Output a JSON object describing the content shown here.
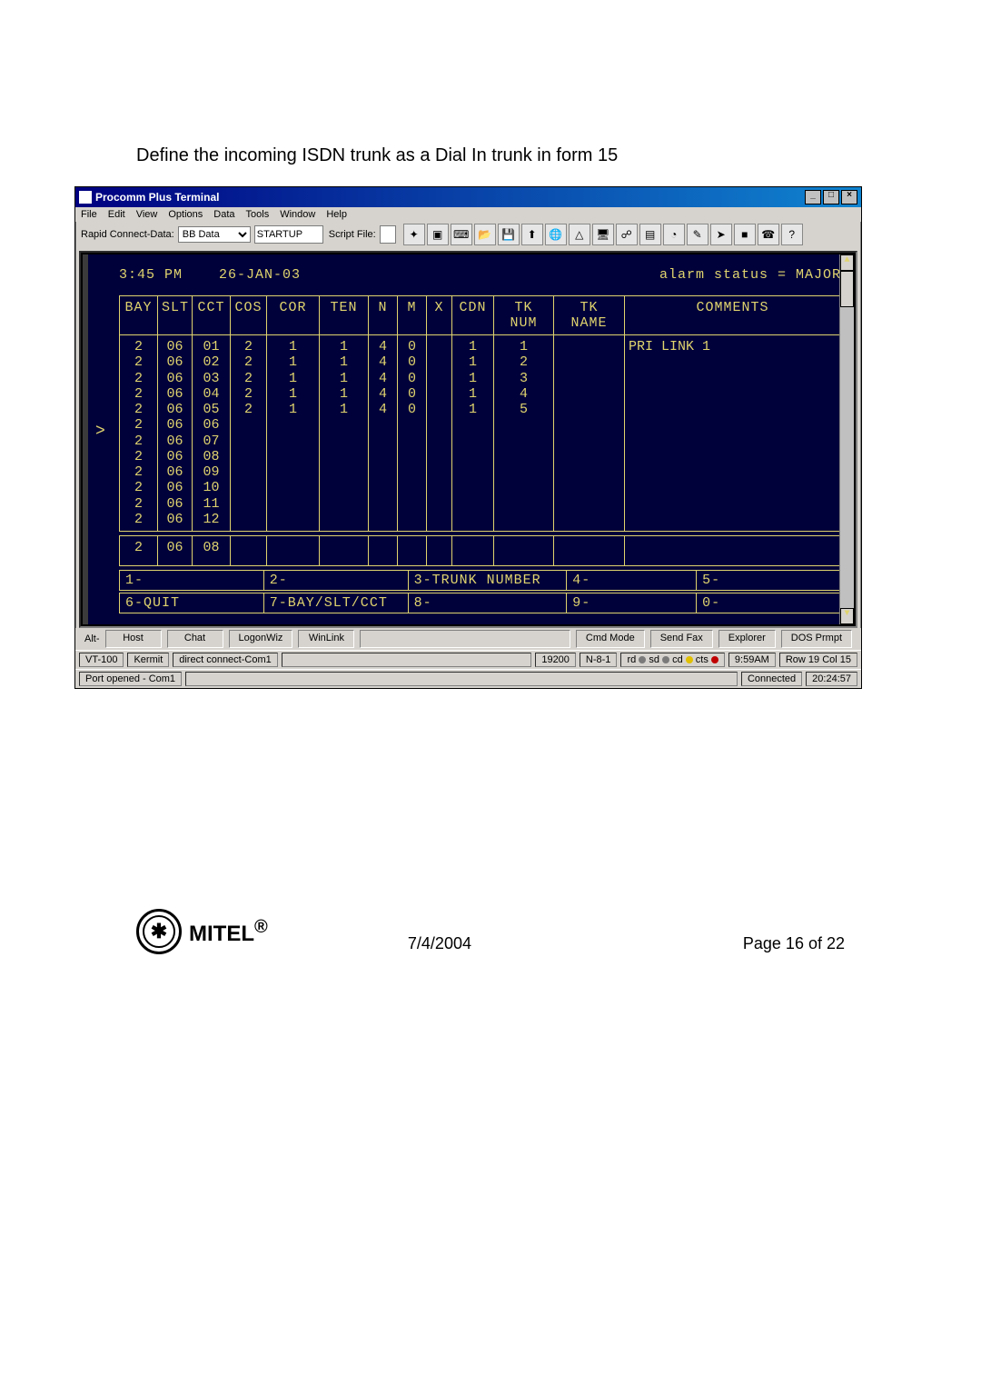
{
  "page": {
    "instruction": "Define the incoming ISDN trunk as a Dial In trunk in form 15"
  },
  "window": {
    "title": "Procomm Plus Terminal",
    "menus": [
      "File",
      "Edit",
      "View",
      "Options",
      "Data",
      "Tools",
      "Window",
      "Help"
    ],
    "tool": {
      "rapid_connect_label": "Rapid Connect-Data:",
      "rapid_connect_value": "BB Data",
      "script_file_label": "Script File:",
      "script_file_value": "STARTUP"
    },
    "toolbar_icons": [
      "run-icon",
      "book-icon",
      "keypad-icon",
      "folder-open-icon",
      "folder-save-icon",
      "upload-icon",
      "globe-icon",
      "triangle-icon",
      "monitor-icon",
      "script-icon",
      "page-icon",
      "clock-icon",
      "paint-icon",
      "arrow-icon",
      "stop-icon",
      "phone-icon",
      "help-icon"
    ]
  },
  "terminal": {
    "time": "3:45 PM",
    "date": "26-JAN-03",
    "alarm": "alarm status = MAJOR",
    "headers": [
      "BAY",
      "SLT",
      "CCT",
      "COS",
      "COR",
      "TEN",
      "N",
      "M",
      "X",
      "CDN",
      "TK NUM",
      "TK NAME",
      "COMMENTS"
    ],
    "rows": [
      {
        "bay": "2",
        "slt": "06",
        "cct": "01",
        "cos": "2",
        "cor": "1",
        "ten": "1",
        "n": "4",
        "m": "0",
        "x": "",
        "cdn": "1",
        "tknum": "1",
        "tkname": "",
        "comments": "PRI LINK 1"
      },
      {
        "bay": "2",
        "slt": "06",
        "cct": "02",
        "cos": "2",
        "cor": "1",
        "ten": "1",
        "n": "4",
        "m": "0",
        "x": "",
        "cdn": "1",
        "tknum": "2",
        "tkname": "",
        "comments": ""
      },
      {
        "bay": "2",
        "slt": "06",
        "cct": "03",
        "cos": "2",
        "cor": "1",
        "ten": "1",
        "n": "4",
        "m": "0",
        "x": "",
        "cdn": "1",
        "tknum": "3",
        "tkname": "",
        "comments": ""
      },
      {
        "bay": "2",
        "slt": "06",
        "cct": "04",
        "cos": "2",
        "cor": "1",
        "ten": "1",
        "n": "4",
        "m": "0",
        "x": "",
        "cdn": "1",
        "tknum": "4",
        "tkname": "",
        "comments": ""
      },
      {
        "bay": "2",
        "slt": "06",
        "cct": "05",
        "cos": "2",
        "cor": "1",
        "ten": "1",
        "n": "4",
        "m": "0",
        "x": "",
        "cdn": "1",
        "tknum": "5",
        "tkname": "",
        "comments": ""
      },
      {
        "bay": "2",
        "slt": "06",
        "cct": "06",
        "cos": "",
        "cor": "",
        "ten": "",
        "n": "",
        "m": "",
        "x": "",
        "cdn": "",
        "tknum": "",
        "tkname": "",
        "comments": ""
      },
      {
        "bay": "2",
        "slt": "06",
        "cct": "07",
        "cos": "",
        "cor": "",
        "ten": "",
        "n": "",
        "m": "",
        "x": "",
        "cdn": "",
        "tknum": "",
        "tkname": "",
        "comments": ""
      },
      {
        "bay": "2",
        "slt": "06",
        "cct": "08",
        "cos": "",
        "cor": "",
        "ten": "",
        "n": "",
        "m": "",
        "x": "",
        "cdn": "",
        "tknum": "",
        "tkname": "",
        "comments": ""
      },
      {
        "bay": "2",
        "slt": "06",
        "cct": "09",
        "cos": "",
        "cor": "",
        "ten": "",
        "n": "",
        "m": "",
        "x": "",
        "cdn": "",
        "tknum": "",
        "tkname": "",
        "comments": ""
      },
      {
        "bay": "2",
        "slt": "06",
        "cct": "10",
        "cos": "",
        "cor": "",
        "ten": "",
        "n": "",
        "m": "",
        "x": "",
        "cdn": "",
        "tknum": "",
        "tkname": "",
        "comments": ""
      },
      {
        "bay": "2",
        "slt": "06",
        "cct": "11",
        "cos": "",
        "cor": "",
        "ten": "",
        "n": "",
        "m": "",
        "x": "",
        "cdn": "",
        "tknum": "",
        "tkname": "",
        "comments": ""
      },
      {
        "bay": "2",
        "slt": "06",
        "cct": "12",
        "cos": "",
        "cor": "",
        "ten": "",
        "n": "",
        "m": "",
        "x": "",
        "cdn": "",
        "tknum": "",
        "tkname": "",
        "comments": ""
      }
    ],
    "cursor_row": {
      "bay": "2",
      "slt": "06",
      "cct": "08"
    },
    "fkeys": {
      "r1": {
        "c1": "1-",
        "c2": "2-",
        "c3": "3-TRUNK NUMBER",
        "c4": "4-",
        "c5": "5-"
      },
      "r2": {
        "c1": "6-QUIT",
        "c2": "7-BAY/SLT/CCT",
        "c3": "8-",
        "c4": "9-",
        "c5": "0-"
      }
    }
  },
  "bottom_buttons": {
    "alt": "Alt-",
    "items": [
      "Host",
      "Chat",
      "LogonWiz",
      "WinLink",
      "",
      "Cmd Mode",
      "Send Fax",
      "Explorer",
      "DOS Prmpt"
    ]
  },
  "status1": {
    "term": "VT-100",
    "proto": "Kermit",
    "conn": "direct connect-Com1",
    "baud": "19200",
    "bits": "N-8-1",
    "leds": "rd  sd  cd  cts",
    "time": "9:59AM",
    "rowcol": "Row 19  Col 15"
  },
  "status2": {
    "port": "Port opened - Com1",
    "connected": "Connected",
    "elapsed": "20:24:57"
  },
  "doc_footer": {
    "brand": "MITEL",
    "reg": "®",
    "date": "7/4/2004",
    "page": "Page 16 of 22"
  },
  "chart_data": {
    "type": "table",
    "title": "Form 15 – ISDN trunk Dial In assignment",
    "columns": [
      "BAY",
      "SLT",
      "CCT",
      "COS",
      "COR",
      "TEN",
      "N",
      "M",
      "X",
      "CDN",
      "TK NUM",
      "TK NAME",
      "COMMENTS"
    ],
    "rows": [
      [
        "2",
        "06",
        "01",
        "2",
        "1",
        "1",
        "4",
        "0",
        "",
        "1",
        "1",
        "",
        "PRI LINK 1"
      ],
      [
        "2",
        "06",
        "02",
        "2",
        "1",
        "1",
        "4",
        "0",
        "",
        "1",
        "2",
        "",
        ""
      ],
      [
        "2",
        "06",
        "03",
        "2",
        "1",
        "1",
        "4",
        "0",
        "",
        "1",
        "3",
        "",
        ""
      ],
      [
        "2",
        "06",
        "04",
        "2",
        "1",
        "1",
        "4",
        "0",
        "",
        "1",
        "4",
        "",
        ""
      ],
      [
        "2",
        "06",
        "05",
        "2",
        "1",
        "1",
        "4",
        "0",
        "",
        "1",
        "5",
        "",
        ""
      ],
      [
        "2",
        "06",
        "06",
        "",
        "",
        "",
        "",
        "",
        "",
        "",
        "",
        "",
        ""
      ],
      [
        "2",
        "06",
        "07",
        "",
        "",
        "",
        "",
        "",
        "",
        "",
        "",
        "",
        ""
      ],
      [
        "2",
        "06",
        "08",
        "",
        "",
        "",
        "",
        "",
        "",
        "",
        "",
        "",
        ""
      ],
      [
        "2",
        "06",
        "09",
        "",
        "",
        "",
        "",
        "",
        "",
        "",
        "",
        "",
        ""
      ],
      [
        "2",
        "06",
        "10",
        "",
        "",
        "",
        "",
        "",
        "",
        "",
        "",
        "",
        ""
      ],
      [
        "2",
        "06",
        "11",
        "",
        "",
        "",
        "",
        "",
        "",
        "",
        "",
        "",
        ""
      ],
      [
        "2",
        "06",
        "12",
        "",
        "",
        "",
        "",
        "",
        "",
        "",
        "",
        "",
        ""
      ]
    ]
  }
}
